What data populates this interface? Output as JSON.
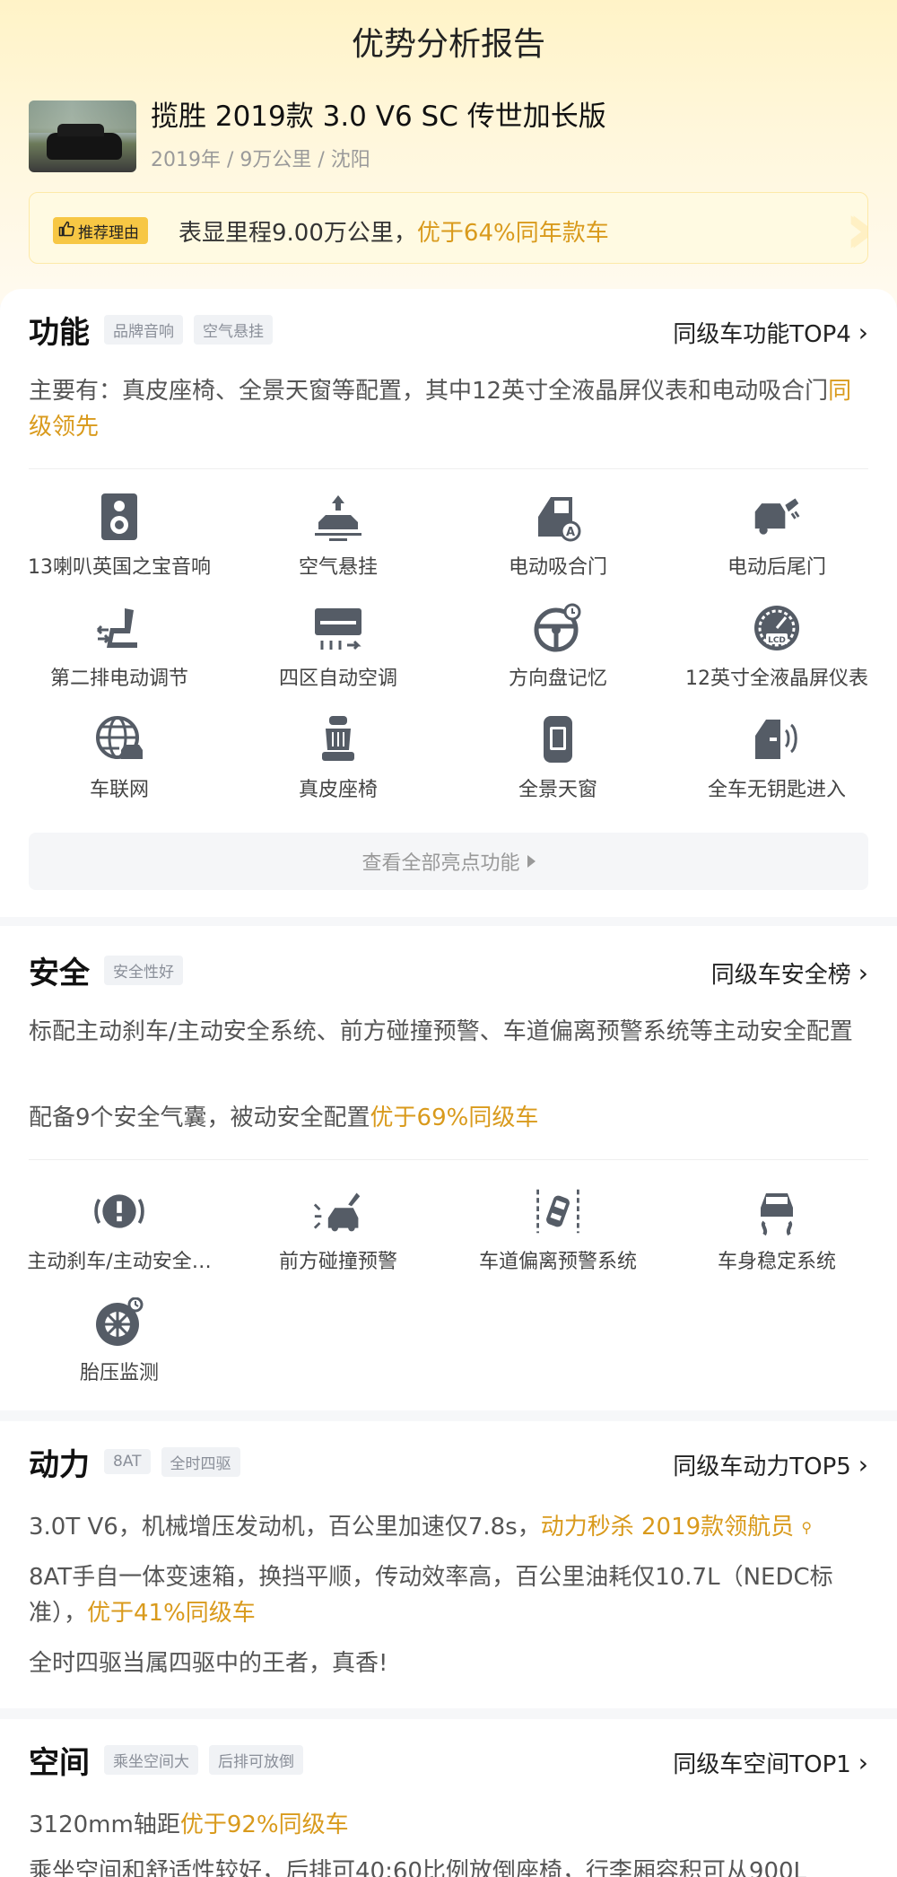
{
  "header": {
    "title": "优势分析报告",
    "car_name": "揽胜 2019款 3.0 V6 SC 传世加长版",
    "car_meta": "2019年 / 9万公里 / 沈阳",
    "reason_badge": "推荐理由",
    "reason_text": "表显里程9.00万公里，",
    "reason_highlight": "优于64%同年款车"
  },
  "features": {
    "title": "功能",
    "tags": [
      "品牌音响",
      "空气悬挂"
    ],
    "link": "同级车功能TOP4",
    "desc": "主要有：真皮座椅、全景天窗等配置，其中12英寸全液晶屏仪表和电动吸合门",
    "desc_highlight": "同级领先",
    "items": [
      {
        "label": "13喇叭英国之宝音响",
        "icon": "speaker-icon"
      },
      {
        "label": "空气悬挂",
        "icon": "air-suspension-icon"
      },
      {
        "label": "电动吸合门",
        "icon": "soft-close-door-icon"
      },
      {
        "label": "电动后尾门",
        "icon": "power-tailgate-icon"
      },
      {
        "label": "第二排电动调节",
        "icon": "power-seat-icon"
      },
      {
        "label": "四区自动空调",
        "icon": "climate-control-icon"
      },
      {
        "label": "方向盘记忆",
        "icon": "steering-memory-icon"
      },
      {
        "label": "12英寸全液晶屏仪表",
        "icon": "lcd-cluster-icon"
      },
      {
        "label": "车联网",
        "icon": "connected-car-icon"
      },
      {
        "label": "真皮座椅",
        "icon": "leather-seat-icon"
      },
      {
        "label": "全景天窗",
        "icon": "panoramic-roof-icon"
      },
      {
        "label": "全车无钥匙进入",
        "icon": "keyless-entry-icon"
      }
    ],
    "more_label": "查看全部亮点功能"
  },
  "safety": {
    "title": "安全",
    "tags": [
      "安全性好"
    ],
    "link": "同级车安全榜",
    "desc1": "标配主动刹车/主动安全系统、前方碰撞预警、车道偏离预警系统等主动安全配置",
    "desc2": "配备9个安全气囊，被动安全配置",
    "desc2_highlight": "优于69%同级车",
    "items": [
      {
        "label": "主动刹车/主动安全…",
        "icon": "active-brake-icon"
      },
      {
        "label": "前方碰撞预警",
        "icon": "collision-warning-icon"
      },
      {
        "label": "车道偏离预警系统",
        "icon": "lane-departure-icon"
      },
      {
        "label": "车身稳定系统",
        "icon": "stability-control-icon"
      },
      {
        "label": "胎压监测",
        "icon": "tire-pressure-icon"
      }
    ]
  },
  "power": {
    "title": "动力",
    "tags": [
      "8AT",
      "全时四驱"
    ],
    "link": "同级车动力TOP5",
    "line1": "3.0T V6，机械增压发动机，百公里加速仅7.8s，",
    "line1_highlight": "动力秒杀 2019款领航员",
    "line2": "8AT手自一体变速箱，换挡平顺，传动效率高，百公里油耗仅10.7L（NEDC标准），",
    "line2_highlight": "优于41%同级车",
    "line3": "全时四驱当属四驱中的王者，真香!"
  },
  "space": {
    "title": "空间",
    "tags": [
      "乘坐空间大",
      "后排可放倒"
    ],
    "link": "同级车空间TOP1",
    "line1": "3120mm轴距",
    "line1_highlight": "优于92%同级车",
    "line2": "乘坐空间和舒适性较好，后排可40:60比例放倒座椅，行李厢容积可从900L"
  },
  "colors": {
    "accent": "#d99a1c",
    "badge": "#f7c744",
    "icon": "#555c66"
  }
}
